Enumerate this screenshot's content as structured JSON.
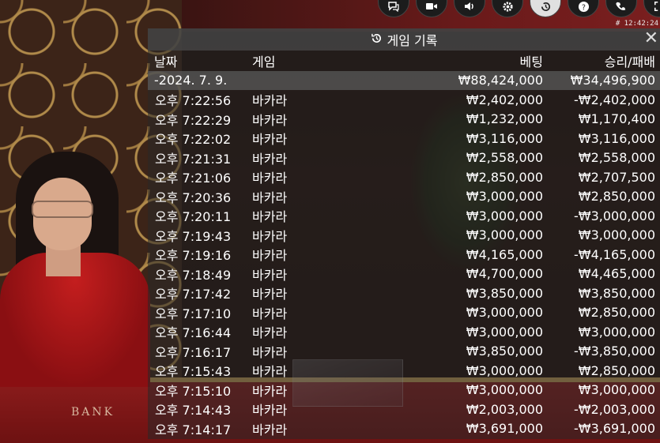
{
  "toolbar": {
    "icons": [
      "chat-icon",
      "video-icon",
      "sound-icon",
      "settings-icon",
      "history-icon",
      "help-icon",
      "phone-icon",
      "fullscreen-icon"
    ],
    "clock": "# 12:42:24"
  },
  "scene": {
    "table_text": "BANK"
  },
  "panel": {
    "title": "게임 기록",
    "close": "✕",
    "columns": {
      "date": "날짜",
      "game": "게임",
      "bet": "베팅",
      "result": "승리/패배"
    },
    "date_row": {
      "date": "-2024. 7. 9.",
      "bet": "₩88,424,000",
      "result": "₩34,496,900"
    },
    "rows": [
      {
        "time": "오후 7:22:56",
        "game": "바카라",
        "bet": "₩2,402,000",
        "result": "-₩2,402,000"
      },
      {
        "time": "오후 7:22:29",
        "game": "바카라",
        "bet": "₩1,232,000",
        "result": "₩1,170,400"
      },
      {
        "time": "오후 7:22:02",
        "game": "바카라",
        "bet": "₩3,116,000",
        "result": "₩3,116,000"
      },
      {
        "time": "오후 7:21:31",
        "game": "바카라",
        "bet": "₩2,558,000",
        "result": "₩2,558,000"
      },
      {
        "time": "오후 7:21:06",
        "game": "바카라",
        "bet": "₩2,850,000",
        "result": "₩2,707,500"
      },
      {
        "time": "오후 7:20:36",
        "game": "바카라",
        "bet": "₩3,000,000",
        "result": "₩2,850,000"
      },
      {
        "time": "오후 7:20:11",
        "game": "바카라",
        "bet": "₩3,000,000",
        "result": "-₩3,000,000"
      },
      {
        "time": "오후 7:19:43",
        "game": "바카라",
        "bet": "₩3,000,000",
        "result": "₩3,000,000"
      },
      {
        "time": "오후 7:19:16",
        "game": "바카라",
        "bet": "₩4,165,000",
        "result": "-₩4,165,000"
      },
      {
        "time": "오후 7:18:49",
        "game": "바카라",
        "bet": "₩4,700,000",
        "result": "₩4,465,000"
      },
      {
        "time": "오후 7:17:42",
        "game": "바카라",
        "bet": "₩3,850,000",
        "result": "₩3,850,000"
      },
      {
        "time": "오후 7:17:10",
        "game": "바카라",
        "bet": "₩3,000,000",
        "result": "₩2,850,000"
      },
      {
        "time": "오후 7:16:44",
        "game": "바카라",
        "bet": "₩3,000,000",
        "result": "₩3,000,000"
      },
      {
        "time": "오후 7:16:17",
        "game": "바카라",
        "bet": "₩3,850,000",
        "result": "-₩3,850,000"
      },
      {
        "time": "오후 7:15:43",
        "game": "바카라",
        "bet": "₩3,000,000",
        "result": "₩2,850,000"
      },
      {
        "time": "오후 7:15:10",
        "game": "바카라",
        "bet": "₩3,000,000",
        "result": "₩3,000,000"
      },
      {
        "time": "오후 7:14:43",
        "game": "바카라",
        "bet": "₩2,003,000",
        "result": "-₩2,003,000"
      },
      {
        "time": "오후 7:14:17",
        "game": "바카라",
        "bet": "₩3,691,000",
        "result": "-₩3,691,000"
      }
    ]
  }
}
